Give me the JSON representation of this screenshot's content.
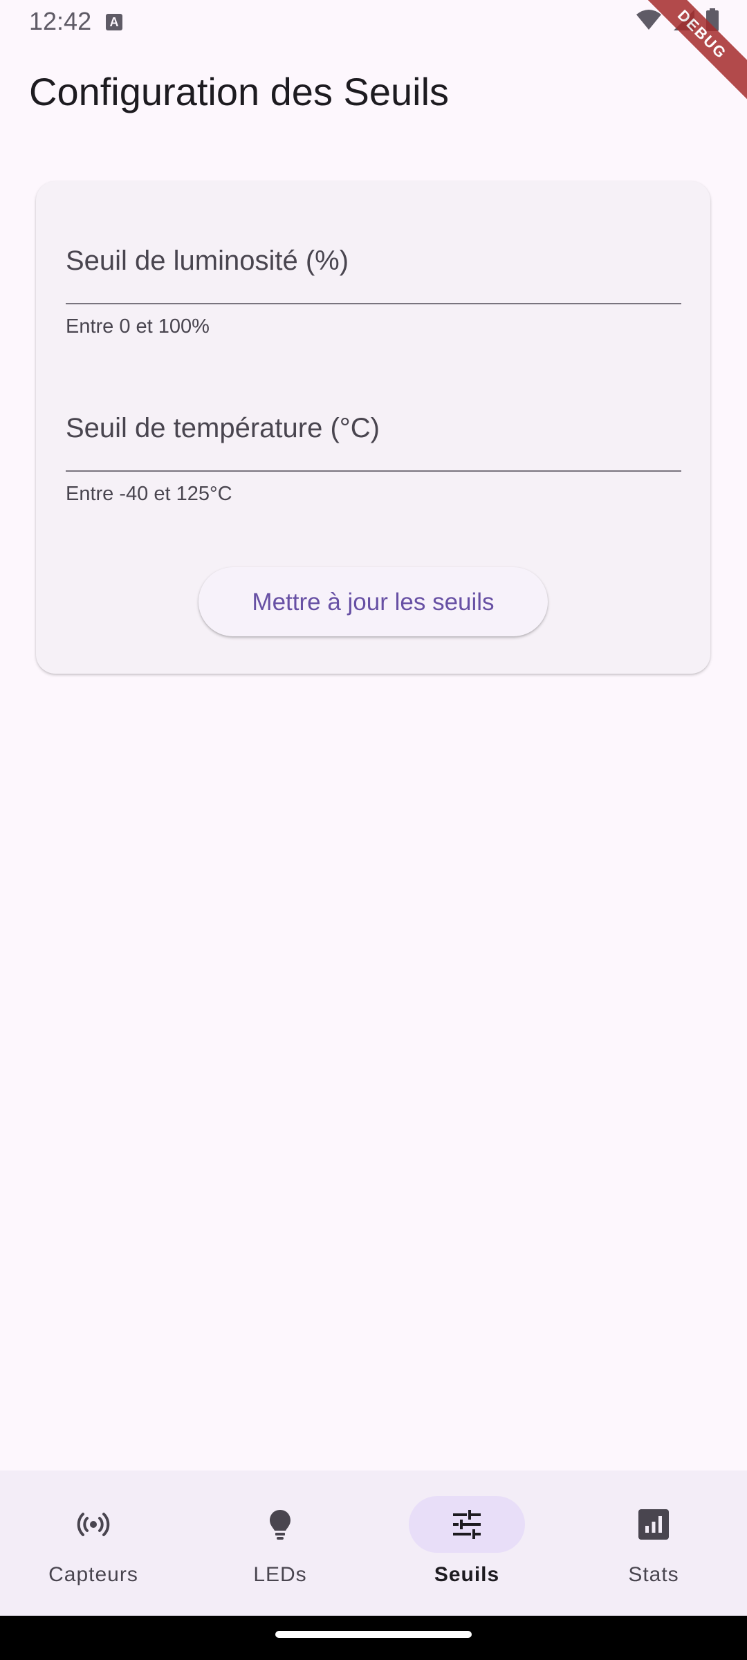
{
  "status_bar": {
    "time": "12:42",
    "notification_icon": "a-icon",
    "indicators": [
      "wifi-icon",
      "signal-icon",
      "battery-icon"
    ]
  },
  "debug_banner": "DEBUG",
  "app_bar": {
    "title": "Configuration des Seuils"
  },
  "form": {
    "luminosity": {
      "label": "Seuil de luminosité (%)",
      "value": "",
      "helper": "Entre 0 et 100%"
    },
    "temperature": {
      "label": "Seuil de température (°C)",
      "value": "",
      "helper": "Entre -40 et 125°C"
    },
    "submit_label": "Mettre à jour les seuils"
  },
  "bottom_nav": {
    "items": [
      {
        "label": "Capteurs",
        "icon": "sensors-icon",
        "active": false
      },
      {
        "label": "LEDs",
        "icon": "lightbulb-icon",
        "active": false
      },
      {
        "label": "Seuils",
        "icon": "tune-icon",
        "active": true
      },
      {
        "label": "Stats",
        "icon": "stats-icon",
        "active": false
      }
    ]
  },
  "colors": {
    "background": "#fdf7fd",
    "card": "#f6f1f7",
    "primary": "#6750a4",
    "nav_background": "#f3edf7",
    "nav_indicator": "#e8def8",
    "debug": "#a52d2d"
  }
}
